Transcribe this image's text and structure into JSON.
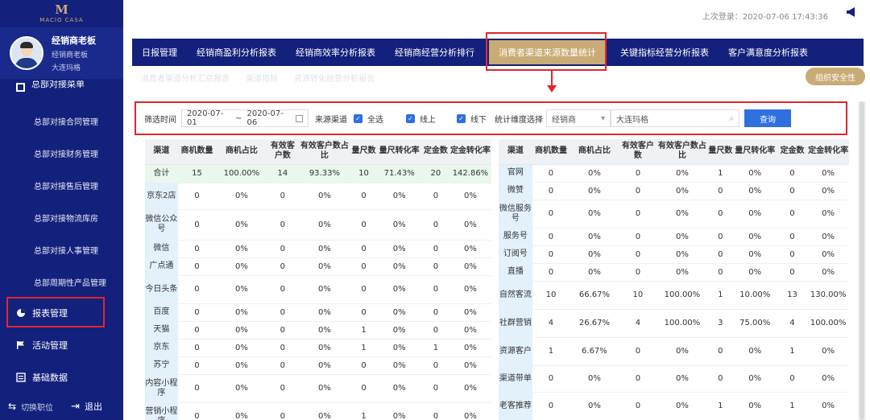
{
  "app": {
    "logo": "MACIO CASA",
    "user": {
      "name": "经销商老板",
      "role": "经销商老板",
      "location": "大连玛格"
    },
    "last_login": "上次登录：2020-07-06 17:43:36"
  },
  "sidebar": {
    "top_item": "总部对接菜单",
    "sub_items": [
      "总部对接合同管理",
      "总部对接财务管理",
      "总部对接售后管理",
      "总部对接物流库房",
      "总部对接人事管理",
      "总部周期性产品管理"
    ],
    "items": [
      "报表管理",
      "活动管理",
      "基础数据"
    ],
    "footer": {
      "switch": "切换职位",
      "logout": "退出"
    }
  },
  "tabs": [
    "日报管理",
    "经销商盈利分析报表",
    "经销商效率分析报表",
    "经销商经营分析排行",
    "消费者渠道来源数量统计",
    "关键指标经营分析报表",
    "客户满意度分析报表"
  ],
  "subtabs": [
    "消费者渠道分析汇总报表",
    "渠道指标",
    "资源转化经营分析报告"
  ],
  "org_btn": "组织安全性",
  "filter": {
    "time_label": "筛选时间",
    "date_start": "2020-07-01",
    "date_sep": "~",
    "date_end": "2020-07-06",
    "channel_label": "来源渠道",
    "opt_all": "全选",
    "opt_online": "线上",
    "opt_offline": "线下",
    "dim_label": "统计维度选择",
    "dim_value": "经销商",
    "search_value": "大连玛格",
    "query": "查询"
  },
  "table_left": {
    "headers": [
      "渠道",
      "商机数量",
      "商机占比",
      "有效客户数",
      "有效客户数占比",
      "量尺数",
      "量尺转化率",
      "定金数",
      "定金转化率"
    ],
    "rows": [
      [
        "合计",
        "15",
        "100.00%",
        "14",
        "93.33%",
        "10",
        "71.43%",
        "20",
        "142.86%"
      ],
      [
        "京东2店",
        "0",
        "0%",
        "0",
        "0%",
        "0",
        "0%",
        "0",
        "0%"
      ],
      [
        "微信公众号",
        "0",
        "0%",
        "0",
        "0%",
        "0",
        "0%",
        "0",
        "0%"
      ],
      [
        "微信",
        "0",
        "0%",
        "0",
        "0%",
        "0",
        "0%",
        "0",
        "0%"
      ],
      [
        "广点通",
        "0",
        "0%",
        "0",
        "0%",
        "0",
        "0%",
        "0",
        "0%"
      ],
      [
        "今日头条",
        "0",
        "0%",
        "0",
        "0%",
        "0",
        "0%",
        "0",
        "0%"
      ],
      [
        "百度",
        "0",
        "0%",
        "0",
        "0%",
        "0",
        "0%",
        "0",
        "0%"
      ],
      [
        "天猫",
        "0",
        "0%",
        "0",
        "0%",
        "1",
        "0%",
        "0",
        "0%"
      ],
      [
        "京东",
        "0",
        "0%",
        "0",
        "0%",
        "1",
        "0%",
        "1",
        "0%"
      ],
      [
        "苏宁",
        "0",
        "0%",
        "0",
        "0%",
        "0",
        "0%",
        "0",
        "0%"
      ],
      [
        "内容小程序",
        "0",
        "0%",
        "0",
        "0%",
        "0",
        "0%",
        "0",
        "0%"
      ],
      [
        "营销小程序",
        "0",
        "0%",
        "0",
        "0%",
        "1",
        "0%",
        "0",
        "0%"
      ]
    ]
  },
  "table_right": {
    "headers": [
      "渠道",
      "商机数量",
      "商机占比",
      "有效客户数",
      "有效客户数占比",
      "量尺数",
      "量尺转化率",
      "定金数",
      "定金转化率"
    ],
    "rows": [
      [
        "官网",
        "0",
        "0%",
        "0",
        "0%",
        "1",
        "0%",
        "0",
        "0%"
      ],
      [
        "微赞",
        "0",
        "0%",
        "0",
        "0%",
        "0",
        "0%",
        "0",
        "0%"
      ],
      [
        "微信服务号",
        "0",
        "0%",
        "0",
        "0%",
        "0",
        "0%",
        "0",
        "0%"
      ],
      [
        "服务号",
        "0",
        "0%",
        "0",
        "0%",
        "0",
        "0%",
        "0",
        "0%"
      ],
      [
        "订阅号",
        "0",
        "0%",
        "0",
        "0%",
        "0",
        "0%",
        "0",
        "0%"
      ],
      [
        "直播",
        "0",
        "0%",
        "0",
        "0%",
        "0",
        "0%",
        "0",
        "0%"
      ],
      [
        "自然客流",
        "10",
        "66.67%",
        "10",
        "100.00%",
        "1",
        "10.00%",
        "13",
        "130.00%"
      ],
      [
        "社群营销",
        "4",
        "26.67%",
        "4",
        "100.00%",
        "3",
        "75.00%",
        "4",
        "100.00%"
      ],
      [
        "资源客户",
        "1",
        "6.67%",
        "0",
        "0%",
        "0",
        "0%",
        "1",
        "0%"
      ],
      [
        "渠道带单",
        "0",
        "0%",
        "0",
        "0%",
        "0",
        "0%",
        "0",
        "0%"
      ],
      [
        "老客推荐",
        "0",
        "0%",
        "0",
        "0%",
        "1",
        "0%",
        "1",
        "0%"
      ]
    ]
  }
}
